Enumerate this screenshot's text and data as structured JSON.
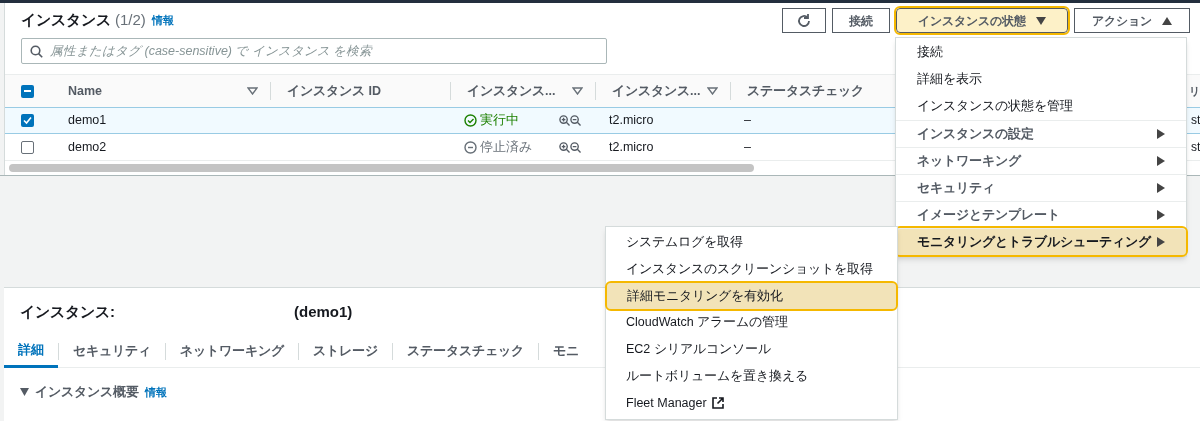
{
  "header": {
    "title": "インスタンス",
    "count": "(1/2)",
    "info_link": "情報"
  },
  "toolbar": {
    "buttons": [
      {
        "kind": "refresh"
      },
      {
        "kind": "text",
        "label": "接続",
        "highlighted": false
      },
      {
        "kind": "dropdown",
        "label": "インスタンスの状態",
        "expanded": false,
        "highlighted": true
      },
      {
        "kind": "dropdown",
        "label": "アクション",
        "expanded": true,
        "highlighted": false
      }
    ]
  },
  "search": {
    "placeholder": "属性またはタグ (case-sensitive) で インスタンス を検索"
  },
  "table": {
    "select_all": {
      "checked": true,
      "partial": true
    },
    "columns": [
      {
        "label": "Name",
        "filter": true
      },
      {
        "label": "インスタンス ID",
        "filter": false
      },
      {
        "label": "インスタンス...",
        "filter": true
      },
      {
        "label": "インスタンス...",
        "filter": true
      },
      {
        "label": "ステータスチェック"
      },
      {
        "label": "リ"
      }
    ],
    "rows": [
      {
        "selected": true,
        "name": "demo1",
        "state": "実行中",
        "kind": "running",
        "type": "t2.micro",
        "status_check": "–",
        "column_6": "st"
      },
      {
        "selected": false,
        "name": "demo2",
        "state": "停止済み",
        "kind": "stopped",
        "type": "t2.micro",
        "status_check": "–",
        "column_6": "st"
      }
    ]
  },
  "details": {
    "title": "インスタンス:",
    "instance": "(demo1)",
    "tabs": [
      {
        "label": "詳細",
        "selected": true
      },
      {
        "label": "セキュリティ",
        "selected": false
      },
      {
        "label": "ネットワーキング",
        "selected": false
      },
      {
        "label": "ストレージ",
        "selected": false
      },
      {
        "label": "ステータスチェック",
        "selected": false
      },
      {
        "label": "モニ",
        "selected": false
      }
    ],
    "section": {
      "title": "インスタンス概要",
      "info_link": "情報",
      "expanded": true
    }
  },
  "state_menu": {
    "items": [
      {
        "label": "接続",
        "submenu": false,
        "selected": false
      },
      {
        "label": "詳細を表示",
        "submenu": false,
        "selected": false
      },
      {
        "label": "インスタンスの状態を管理",
        "submenu": false,
        "selected": false
      },
      {
        "label": "インスタンスの設定",
        "submenu": true,
        "selected": false
      },
      {
        "label": "ネットワーキング",
        "submenu": true,
        "selected": false
      },
      {
        "label": "セキュリティ",
        "submenu": true,
        "selected": false
      },
      {
        "label": "イメージとテンプレート",
        "submenu": true,
        "selected": false
      },
      {
        "label": "モニタリングとトラブルシューティング",
        "submenu": true,
        "selected": true
      }
    ]
  },
  "submenu": {
    "items": [
      {
        "label": "システムログを取得",
        "selected": false,
        "external": false
      },
      {
        "label": "インスタンスのスクリーンショットを取得",
        "selected": false,
        "external": false
      },
      {
        "label": "詳細モニタリングを有効化",
        "selected": true,
        "external": false
      },
      {
        "label": "CloudWatch アラームの管理",
        "selected": false,
        "external": false
      },
      {
        "label": "EC2 シリアルコンソール",
        "selected": false,
        "external": false
      },
      {
        "label": "ルートボリュームを置き換える",
        "selected": false,
        "external": false
      },
      {
        "label": "Fleet Manager",
        "selected": false,
        "external": true
      }
    ]
  }
}
